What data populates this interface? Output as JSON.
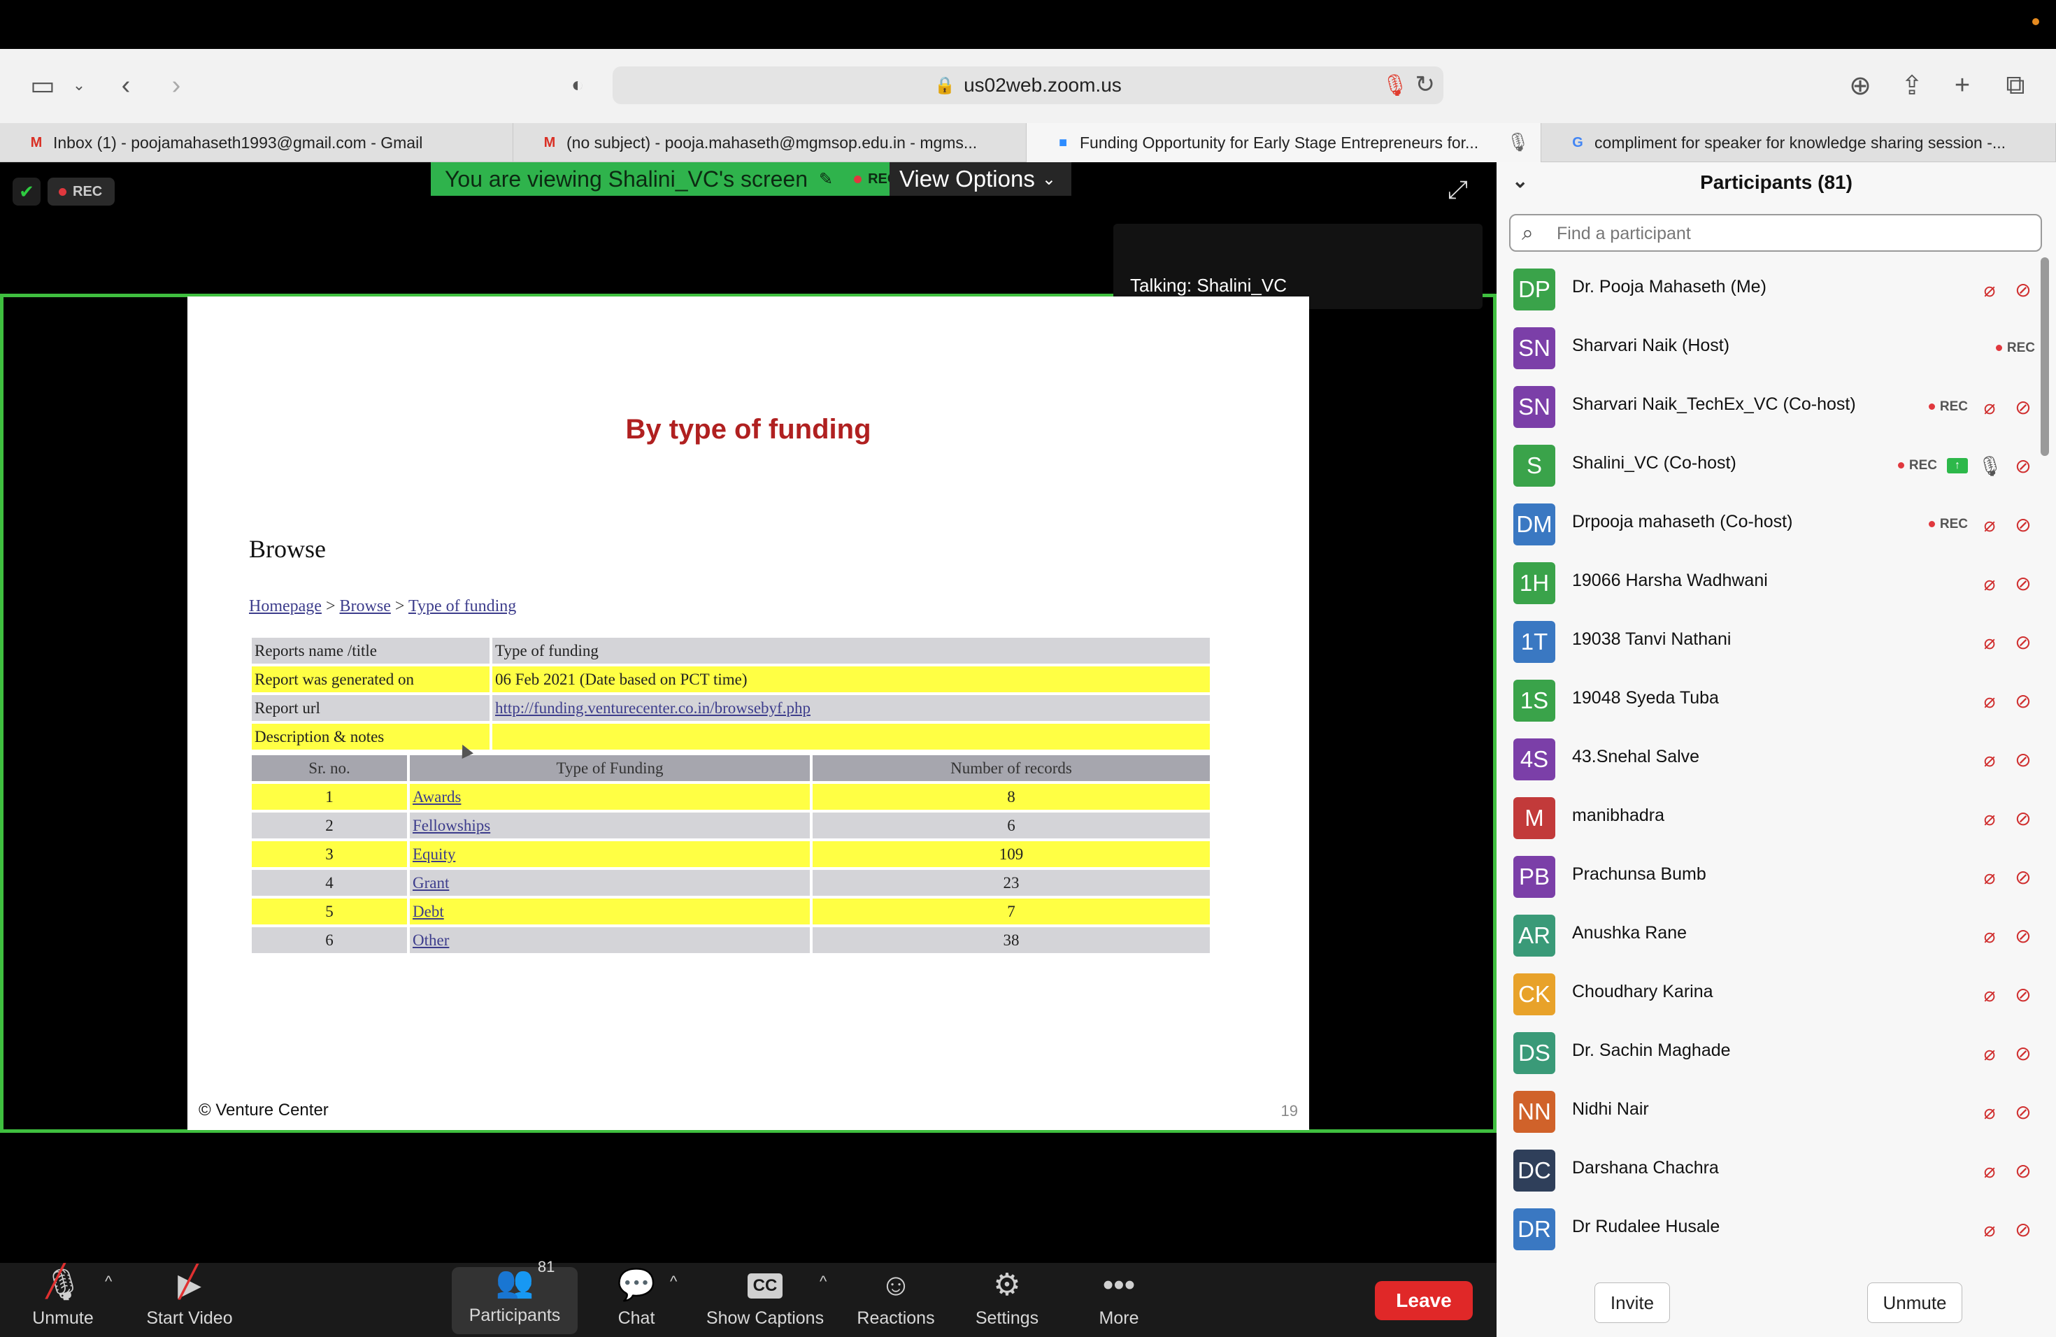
{
  "browser": {
    "url": "us02web.zoom.us",
    "tabs": [
      {
        "label": "Inbox (1) - poojamahaseth1993@gmail.com - Gmail",
        "icon": "M"
      },
      {
        "label": "(no subject) - pooja.mahaseth@mgmsop.edu.in - mgms...",
        "icon": "M"
      },
      {
        "label": "Funding Opportunity for Early Stage Entrepreneurs for...",
        "icon": "■"
      },
      {
        "label": "compliment for speaker for knowledge sharing session -...",
        "icon": "G"
      }
    ]
  },
  "meeting": {
    "rec_label": "REC",
    "viewing_banner": "You are viewing Shalini_VC's screen",
    "view_options": "View Options",
    "talking": "Talking: Shalini_VC"
  },
  "slide": {
    "title": "By type of funding",
    "heading": "Browse",
    "breadcrumb": {
      "home": "Homepage",
      "sep": " > ",
      "browse": "Browse",
      "current": "Type of funding"
    },
    "meta": [
      {
        "key": "Reports name /title",
        "value": "Type of funding",
        "link": false
      },
      {
        "key": "Report was generated on",
        "value": "06 Feb 2021 (Date based on PCT time)",
        "link": false
      },
      {
        "key": "Report url",
        "value": "http://funding.venturecenter.co.in/browsebyf.php",
        "link": true
      },
      {
        "key": "Description & notes",
        "value": "",
        "link": false
      }
    ],
    "table_headers": [
      "Sr. no.",
      "Type of Funding",
      "Number of records"
    ],
    "table_rows": [
      {
        "sr": "1",
        "type": "Awards",
        "count": "8"
      },
      {
        "sr": "2",
        "type": "Fellowships",
        "count": "6"
      },
      {
        "sr": "3",
        "type": "Equity",
        "count": "109"
      },
      {
        "sr": "4",
        "type": "Grant",
        "count": "23"
      },
      {
        "sr": "5",
        "type": "Debt",
        "count": "7"
      },
      {
        "sr": "6",
        "type": "Other",
        "count": "38"
      }
    ],
    "footer": "© Venture Center",
    "page_number": "19"
  },
  "toolbar": {
    "unmute": "Unmute",
    "start_video": "Start Video",
    "participants": "Participants",
    "participants_count": "81",
    "chat": "Chat",
    "show_captions": "Show Captions",
    "captions_icon": "CC",
    "reactions": "Reactions",
    "settings": "Settings",
    "more": "More",
    "leave": "Leave"
  },
  "panel": {
    "title": "Participants (81)",
    "search_placeholder": "Find a participant",
    "invite": "Invite",
    "unmute": "Unmute",
    "participants": [
      {
        "initials": "DP",
        "name": "Dr. Pooja Mahaseth (Me)",
        "color": "#3aa34a",
        "rec": false,
        "share": false,
        "mic": "off",
        "video": true
      },
      {
        "initials": "SN",
        "name": "Sharvari Naik (Host)",
        "color": "#7b3fa8",
        "rec": true,
        "share": false,
        "mic": "none",
        "video": false
      },
      {
        "initials": "SN",
        "name": "Sharvari Naik_TechEx_VC (Co-host)",
        "color": "#7b3fa8",
        "rec": true,
        "share": false,
        "mic": "off",
        "video": true
      },
      {
        "initials": "S",
        "name": "Shalini_VC (Co-host)",
        "color": "#3aa34a",
        "rec": true,
        "share": true,
        "mic": "on",
        "video": true
      },
      {
        "initials": "DM",
        "name": "Drpooja mahaseth (Co-host)",
        "color": "#3a78c2",
        "rec": true,
        "share": false,
        "mic": "off",
        "video": true
      },
      {
        "initials": "1H",
        "name": "19066 Harsha Wadhwani",
        "color": "#3aa34a",
        "rec": false,
        "share": false,
        "mic": "off",
        "video": true
      },
      {
        "initials": "1T",
        "name": "19038 Tanvi Nathani",
        "color": "#3a78c2",
        "rec": false,
        "share": false,
        "mic": "off",
        "video": true
      },
      {
        "initials": "1S",
        "name": "19048 Syeda Tuba",
        "color": "#3aa34a",
        "rec": false,
        "share": false,
        "mic": "off",
        "video": true
      },
      {
        "initials": "4S",
        "name": "43.Snehal Salve",
        "color": "#7b3fa8",
        "rec": false,
        "share": false,
        "mic": "off",
        "video": true
      },
      {
        "initials": "M",
        "name": "manibhadra",
        "color": "#c23a3a",
        "rec": false,
        "share": false,
        "mic": "off",
        "video": true
      },
      {
        "initials": "PB",
        "name": "Prachunsa Bumb",
        "color": "#7b3fa8",
        "rec": false,
        "share": false,
        "mic": "off",
        "video": true
      },
      {
        "initials": "AR",
        "name": "Anushka Rane",
        "color": "#3a9a78",
        "rec": false,
        "share": false,
        "mic": "off",
        "video": true
      },
      {
        "initials": "CK",
        "name": "Choudhary Karina",
        "color": "#e8a22a",
        "rec": false,
        "share": false,
        "mic": "off",
        "video": true
      },
      {
        "initials": "DS",
        "name": "Dr. Sachin Maghade",
        "color": "#3a9a78",
        "rec": false,
        "share": false,
        "mic": "off",
        "video": true
      },
      {
        "initials": "NN",
        "name": "Nidhi Nair",
        "color": "#d0622a",
        "rec": false,
        "share": false,
        "mic": "off",
        "video": true
      },
      {
        "initials": "DC",
        "name": "Darshana Chachra",
        "color": "#2f3f5a",
        "rec": false,
        "share": false,
        "mic": "off",
        "video": true
      },
      {
        "initials": "DR",
        "name": "Dr Rudalee Husale",
        "color": "#3a78c2",
        "rec": false,
        "share": false,
        "mic": "off",
        "video": true
      }
    ]
  }
}
